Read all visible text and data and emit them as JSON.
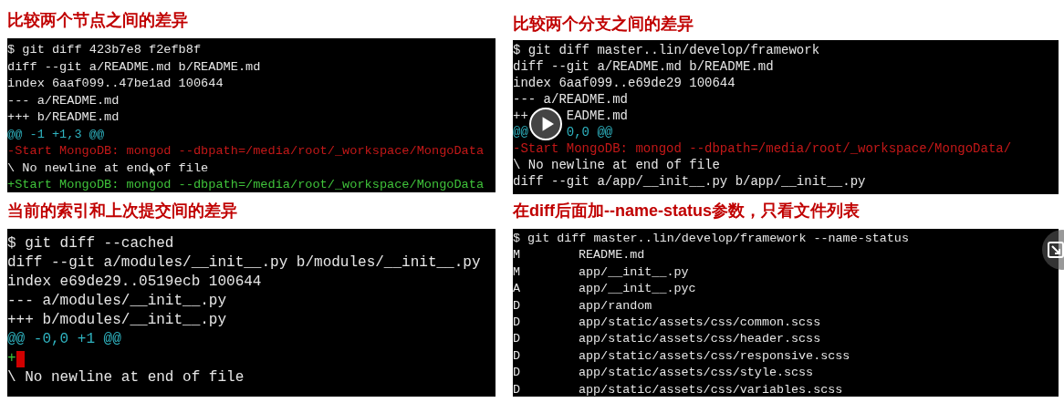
{
  "panels": [
    {
      "title": "比较两个节点之间的差异",
      "lines": [
        {
          "kind": "plain",
          "text": "$ git diff 423b7e8 f2efb8f"
        },
        {
          "kind": "plain",
          "text": "diff --git a/README.md b/README.md"
        },
        {
          "kind": "plain",
          "text": "index 6aaf099..47be1ad 100644"
        },
        {
          "kind": "plain",
          "text": "--- a/README.md"
        },
        {
          "kind": "plain",
          "text": "+++ b/README.md"
        },
        {
          "kind": "hunk",
          "text": "@@ -1 +1,3 @@"
        },
        {
          "kind": "del",
          "text": "-Start MongoDB: mongod --dbpath=/media/root/_workspace/MongoData"
        },
        {
          "kind": "plain",
          "text": "\\ No newline at end of file"
        },
        {
          "kind": "add",
          "text": "+Start MongoDB: mongod --dbpath=/media/root/_workspace/MongoData"
        }
      ],
      "cursor": true
    },
    {
      "title": "比较两个分支之间的差异",
      "lines": [
        {
          "kind": "plain",
          "text": "$ git diff master..lin/develop/framework"
        },
        {
          "kind": "plain",
          "text": "diff --git a/README.md b/README.md"
        },
        {
          "kind": "plain",
          "text": "index 6aaf099..e69de29 100644"
        },
        {
          "kind": "plain",
          "text": "--- a/README.md"
        },
        {
          "kind": "plain",
          "text": "++",
          "text_after": "EADME.md"
        },
        {
          "kind": "hunk",
          "text": "@@",
          "text_after": "0,0 @@"
        },
        {
          "kind": "del",
          "text": "-Start MongoDB: mongod --dbpath=/media/root/_workspace/MongoData/"
        },
        {
          "kind": "plain",
          "text": "\\ No newline at end of file"
        },
        {
          "kind": "plain",
          "text": "diff --git a/app/__init__.py b/app/__init__.py"
        }
      ],
      "play_button": true
    },
    {
      "title": "当前的索引和上次提交间的差异",
      "lines": [
        {
          "kind": "plain",
          "text": "$ git diff --cached"
        },
        {
          "kind": "plain",
          "text": "diff --git a/modules/__init__.py b/modules/__init__.py"
        },
        {
          "kind": "plain",
          "text": "index e69de29..0519ecb 100644"
        },
        {
          "kind": "plain",
          "text": "--- a/modules/__init__.py"
        },
        {
          "kind": "plain",
          "text": "+++ b/modules/__init__.py"
        },
        {
          "kind": "hunk",
          "text": "@@ -0,0 +1 @@"
        },
        {
          "kind": "add",
          "text": "+",
          "trailing_space": true
        },
        {
          "kind": "plain",
          "text": "\\ No newline at end of file"
        }
      ]
    },
    {
      "title": "在diff后面加--name-status参数，只看文件列表",
      "lines": [
        {
          "kind": "plain",
          "text": "$ git diff master..lin/develop/framework --name-status"
        },
        {
          "kind": "file",
          "status": "M",
          "path": "README.md"
        },
        {
          "kind": "file",
          "status": "M",
          "path": "app/__init__.py"
        },
        {
          "kind": "file",
          "status": "A",
          "path": "app/__init__.pyc"
        },
        {
          "kind": "file",
          "status": "D",
          "path": "app/random"
        },
        {
          "kind": "file",
          "status": "D",
          "path": "app/static/assets/css/common.scss"
        },
        {
          "kind": "file",
          "status": "D",
          "path": "app/static/assets/css/header.scss"
        },
        {
          "kind": "file",
          "status": "D",
          "path": "app/static/assets/css/responsive.scss"
        },
        {
          "kind": "file",
          "status": "D",
          "path": "app/static/assets/css/style.scss"
        },
        {
          "kind": "file",
          "status": "D",
          "path": "app/static/assets/css/variables.scss"
        }
      ]
    }
  ],
  "expand_button": true
}
